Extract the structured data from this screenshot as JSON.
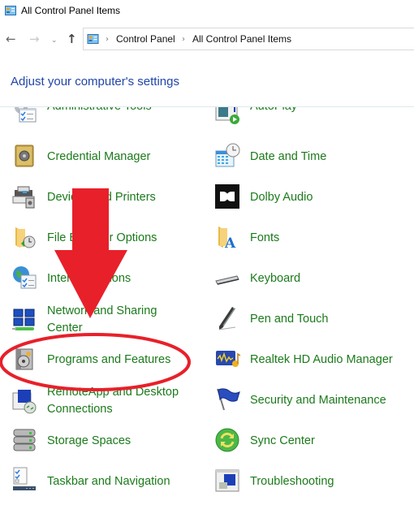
{
  "window": {
    "title": "All Control Panel Items",
    "title_icon": "control-panel-icon"
  },
  "nav": {
    "back": "←",
    "forward": "→",
    "recent": "⌄",
    "up": "↑"
  },
  "address": {
    "icon": "control-panel-icon",
    "separator": "›",
    "crumbs": [
      "Control Panel",
      "All Control Panel Items"
    ]
  },
  "heading": "Adjust your computer's settings",
  "colors": {
    "link_green": "#1b7a1b",
    "heading_blue": "#2246a8",
    "annotation_red": "#e8202a"
  },
  "items_left": [
    {
      "label": "Administrative Tools",
      "icon": "administrative-tools-icon"
    },
    {
      "label": "Credential Manager",
      "icon": "credential-manager-icon"
    },
    {
      "label": "Devices and Printers",
      "icon": "devices-printers-icon"
    },
    {
      "label": "File Explorer Options",
      "icon": "file-explorer-options-icon"
    },
    {
      "label": "Internet Options",
      "icon": "internet-options-icon"
    },
    {
      "label": "Network and Sharing",
      "label2": "Center",
      "icon": "network-sharing-icon"
    },
    {
      "label": "Programs and Features",
      "icon": "programs-features-icon"
    },
    {
      "label": "RemoteApp and Desktop",
      "label2": "Connections",
      "icon": "remoteapp-icon"
    },
    {
      "label": "Storage Spaces",
      "icon": "storage-spaces-icon"
    },
    {
      "label": "Taskbar and Navigation",
      "icon": "taskbar-navigation-icon"
    }
  ],
  "items_right": [
    {
      "label": "AutoPlay",
      "icon": "autoplay-icon"
    },
    {
      "label": "Date and Time",
      "icon": "date-time-icon"
    },
    {
      "label": "Dolby Audio",
      "icon": "dolby-audio-icon"
    },
    {
      "label": "Fonts",
      "icon": "fonts-icon"
    },
    {
      "label": "Keyboard",
      "icon": "keyboard-icon"
    },
    {
      "label": "Pen and Touch",
      "icon": "pen-touch-icon"
    },
    {
      "label": "Realtek HD Audio Manager",
      "icon": "realtek-audio-icon"
    },
    {
      "label": "Security and Maintenance",
      "icon": "security-maintenance-icon"
    },
    {
      "label": "Sync Center",
      "icon": "sync-center-icon"
    },
    {
      "label": "Troubleshooting",
      "icon": "troubleshooting-icon"
    }
  ],
  "annotations": {
    "arrow": "red-arrow-pointing-down",
    "highlight": "red-ellipse-around-programs-and-features"
  }
}
